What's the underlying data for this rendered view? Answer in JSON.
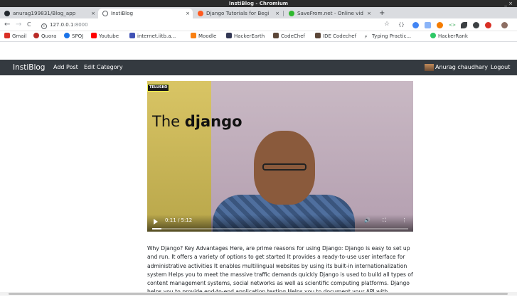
{
  "window": {
    "title": "InstiBlog - Chromium",
    "controls": "_ ×"
  },
  "tabs": [
    {
      "label": "anurag199831/Blog_app",
      "icon": "github-icon",
      "color": "#24292e",
      "active": false
    },
    {
      "label": "InstiBlog",
      "icon": "globe-icon",
      "color": "#5f6368",
      "active": true
    },
    {
      "label": "Django Tutorials for Begi",
      "icon": "youtube-icon",
      "color": "#ff0000",
      "active": false
    },
    {
      "label": "SaveFrom.net - Online vid",
      "icon": "savefrom-icon",
      "color": "#2eb82e",
      "active": false
    }
  ],
  "toolbar": {
    "back": "←",
    "forward": "→",
    "reload": "C",
    "url_host": "127.0.0.1",
    "url_port": ":8000",
    "info_icon": "i",
    "bookmark_star": "☆"
  },
  "extensions": [
    {
      "name": "json-viewer-icon",
      "color": "#5f6368"
    },
    {
      "name": "extension-blue-icon",
      "color": "#4285f4"
    },
    {
      "name": "shield-icon",
      "color": "#8ab4f8"
    },
    {
      "name": "extension-orange-icon",
      "color": "#f57c00"
    },
    {
      "name": "code-icon",
      "color": "#34a853"
    },
    {
      "name": "leaf-icon",
      "color": "#3c4043"
    },
    {
      "name": "moon-icon",
      "color": "#3c4043"
    },
    {
      "name": "adblock-icon",
      "color": "#d93025"
    },
    {
      "name": "profile-icon",
      "color": "#8d6e63"
    }
  ],
  "bookmarks": [
    {
      "label": "Gmail",
      "icon": "gmail-icon",
      "color": "#d93025"
    },
    {
      "label": "Quora",
      "icon": "quora-icon",
      "color": "#b92b27"
    },
    {
      "label": "SPOJ",
      "icon": "spoj-icon",
      "color": "#1a73e8"
    },
    {
      "label": "Youtube",
      "icon": "youtube-icon",
      "color": "#ff0000"
    },
    {
      "label": "internet.iitb.a...",
      "icon": "iitb-icon",
      "color": "#3f51b5"
    },
    {
      "label": "Moodle",
      "icon": "moodle-icon",
      "color": "#f98012"
    },
    {
      "label": "HackerEarth",
      "icon": "hackerearth-icon",
      "color": "#323754"
    },
    {
      "label": "CodeChef",
      "icon": "codechef-icon",
      "color": "#5b4638"
    },
    {
      "label": "IDE Codechef",
      "icon": "codechef-icon",
      "color": "#5b4638"
    },
    {
      "label": "Typing Practic...",
      "icon": "typing-icon",
      "color": "#3c4043"
    },
    {
      "label": "HackerRank",
      "icon": "hackerrank-icon",
      "color": "#2ec866"
    }
  ],
  "appnav": {
    "brand": "InstiBlog",
    "links": [
      "Add Post",
      "Edit Category"
    ],
    "user": "Anurag chaudhary",
    "logout": "Logout",
    "bg_color": "#343a40"
  },
  "video": {
    "badge": "TELUSKO",
    "headline_prefix": "The ",
    "headline_bold": "django",
    "time": "0:11 / 5:12",
    "progress": 0.035
  },
  "description": "Why Django? Key Advantages Here, are prime reasons for using Django: Django is easy to set up and run. It offers a variety of options to get started It provides a ready-to-use user interface for administrative activities It enables multilingual websites by using its built-in internationalization system Helps you to meet the massive traffic demands quickly Django is used to build all types of content management systems, social networks as well as scientific computing platforms. Django helps you to provide end-to-end application testing Helps you to document your API with"
}
